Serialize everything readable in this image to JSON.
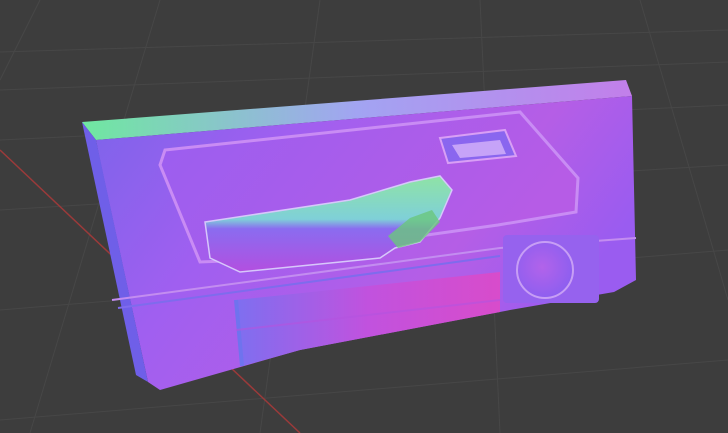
{
  "viewport": {
    "background": "#3d3d3d",
    "grid_color": "#4a4a4a",
    "x_axis_color": "#9b3a3a",
    "shading": "normal-map"
  },
  "object": {
    "type": "car door panel",
    "base_color": "#a860e8",
    "top_edge_color": "#7ee88a",
    "left_edge_color": "#6f5fe8",
    "bottom_pocket_color": "#d64bd6"
  }
}
